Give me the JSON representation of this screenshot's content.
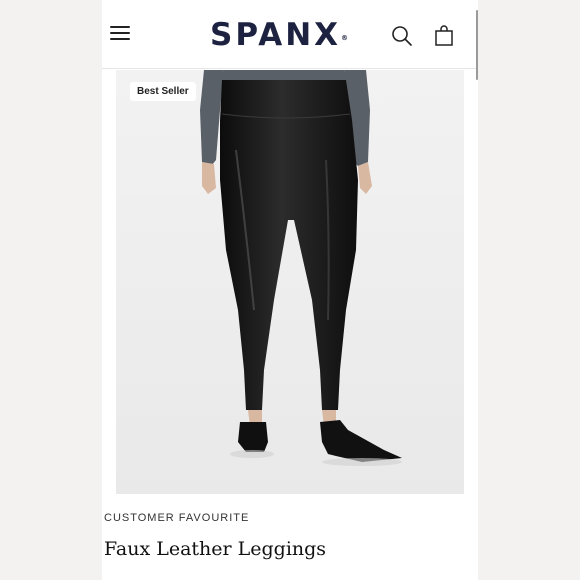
{
  "header": {
    "logo": "SPANX",
    "logo_mark": "®",
    "icons": {
      "menu": "hamburger-menu-icon",
      "search": "search-icon",
      "bag": "shopping-bag-icon"
    }
  },
  "product": {
    "badge": "Best Seller",
    "eyebrow": "CUSTOMER FAVOURITE",
    "title": "Faux Leather Leggings",
    "image": "model-wearing-black-faux-leather-leggings-and-black-mules"
  },
  "colors": {
    "brand": "#1d2240",
    "legging": "#151515",
    "top": "#5a6068"
  }
}
